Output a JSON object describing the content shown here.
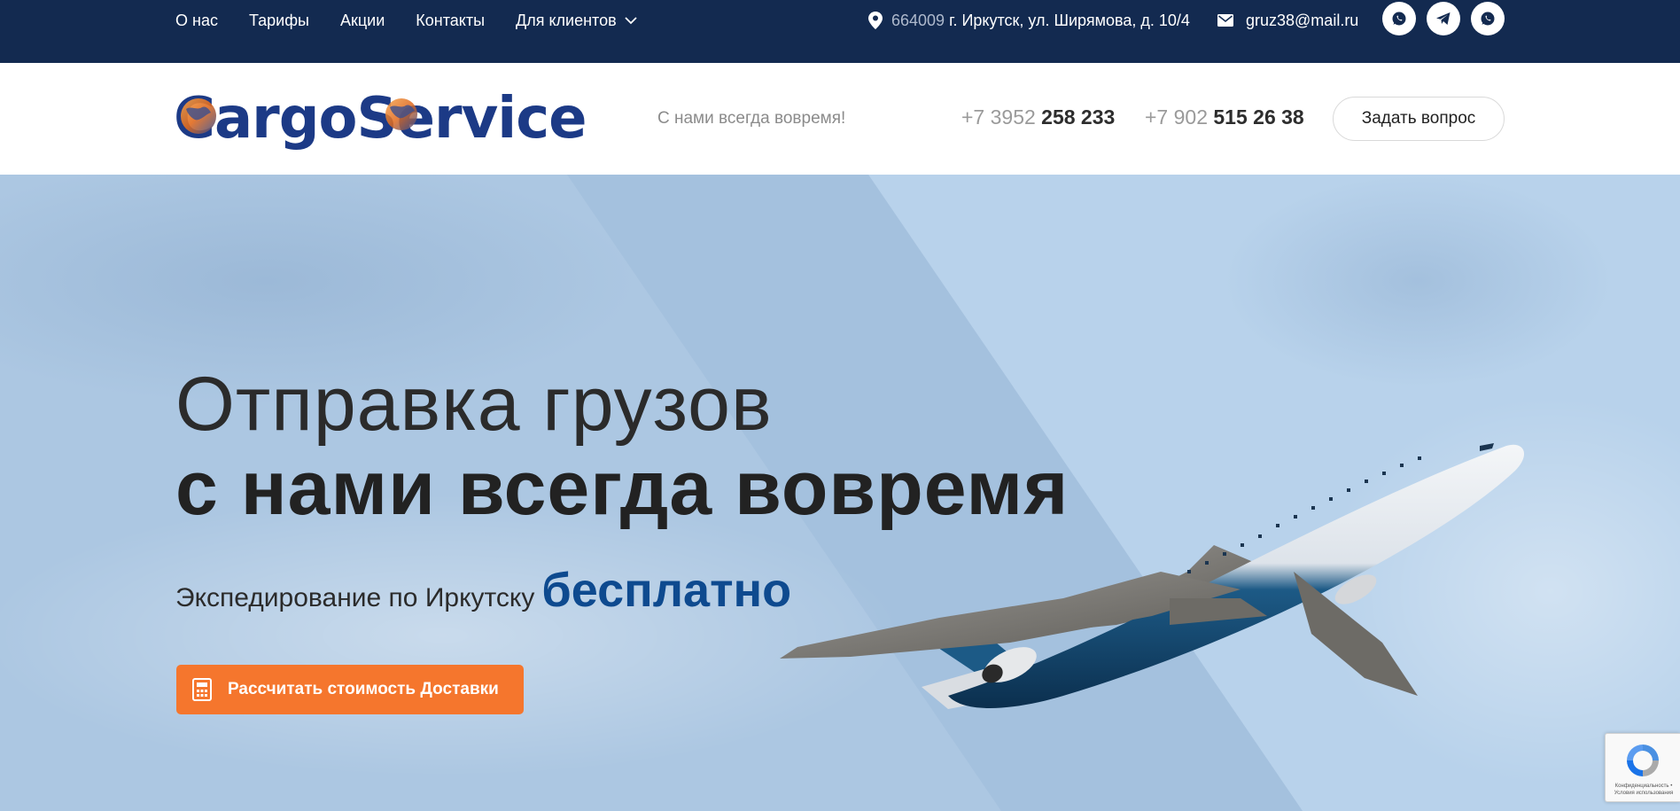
{
  "topbar": {
    "nav": [
      {
        "label": "О нас"
      },
      {
        "label": "Тарифы"
      },
      {
        "label": "Акции"
      },
      {
        "label": "Контакты"
      },
      {
        "label": "Для клиентов"
      }
    ],
    "address": {
      "zip": "664009",
      "street": "г. Иркутск, ул. Ширямова, д. 10/4"
    },
    "email": "gruz38@mail.ru",
    "socials": [
      "whatsapp-icon",
      "telegram-icon",
      "whatsapp-icon"
    ]
  },
  "header": {
    "logo_text": "CargoService",
    "slogan": "С нами всегда вовремя!",
    "phones": [
      {
        "prefix": "+7 3952",
        "number": "258 233"
      },
      {
        "prefix": "+7 902",
        "number": "515 26 38"
      }
    ],
    "ask_button": "Задать вопрос"
  },
  "hero": {
    "title_line1": "Отправка грузов",
    "title_line2": "с нами всегда вовремя",
    "subtitle": "Экспедирование по Иркутску",
    "subtitle_accent": "бесплатно",
    "cta": "Рассчитать стоимость Доставки"
  },
  "recaptcha": {
    "text": "Конфиденциальность • Условия использования"
  },
  "colors": {
    "topbar": "#132a50",
    "accent_orange": "#f5762d",
    "accent_blue": "#0e4a8f",
    "hero_bg": "#b7d1ea"
  }
}
